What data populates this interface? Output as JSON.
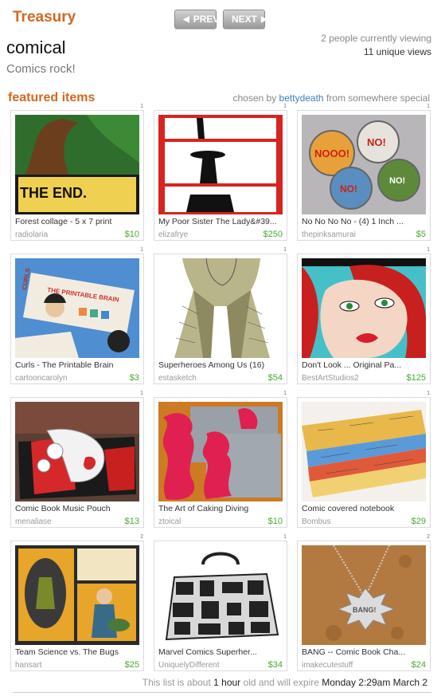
{
  "header": {
    "brand": "Treasury",
    "prev_label": "PREV",
    "next_label": "NEXT",
    "list_title": "comical",
    "list_subtitle": "Comics rock!",
    "viewing": "2 people currently viewing",
    "unique_views": "11 unique views"
  },
  "featured": {
    "heading": "featured items",
    "chosen_by": "chosen by",
    "curator": "bettydeath",
    "from": "from",
    "place": "somewhere special"
  },
  "items": [
    {
      "num": "1",
      "name": "Forest collage - 5 x 7 print",
      "seller": "radiolaria",
      "price": "$10"
    },
    {
      "num": "1",
      "name": "My Poor Sister The Lady&#39...",
      "seller": "elizafrye",
      "price": "$250"
    },
    {
      "num": "1",
      "name": "No No No No - (4) 1 Inch ...",
      "seller": "thepinksamurai",
      "price": "$5"
    },
    {
      "num": "1",
      "name": "Curls - The Printable Brain",
      "seller": "cartooncarolyn",
      "price": "$3"
    },
    {
      "num": "1",
      "name": "Superheroes Among Us (16)",
      "seller": "estasketch",
      "price": "$54"
    },
    {
      "num": "1",
      "name": "Don't Look ... Original Pa...",
      "seller": "BestArtStudios2",
      "price": "$125"
    },
    {
      "num": "1",
      "name": "Comic Book Music Pouch",
      "seller": "menaliase",
      "price": "$13"
    },
    {
      "num": "1",
      "name": "The Art of Caking Diving",
      "seller": "ztoical",
      "price": "$10"
    },
    {
      "num": "1",
      "name": "Comic covered notebook",
      "seller": "Bombus",
      "price": "$29"
    },
    {
      "num": "2",
      "name": "Team Science vs. The Bugs",
      "seller": "hansart",
      "price": "$25"
    },
    {
      "num": "1",
      "name": "Marvel Comics Superher...",
      "seller": "UniquelyDifferent",
      "price": "$34"
    },
    {
      "num": "2",
      "name": "BANG -- Comic Book Cha...",
      "seller": "imakecutestuff",
      "price": "$24"
    }
  ],
  "thumb_texts": {
    "the_end": "THE END.",
    "printable_brain": "THE PRINTABLE BRAIN",
    "curls": "CURLS",
    "bang": "BANG!",
    "nooo": "NOOO!",
    "no": "NO!"
  },
  "footer": {
    "prefix": "This list is about",
    "age": "1 hour",
    "middle": "old and will expire",
    "expires": "Monday 2:29am  March 2"
  },
  "colors": {
    "accent": "#d4671e",
    "price": "#4aa832",
    "link": "#3a7fbd"
  }
}
